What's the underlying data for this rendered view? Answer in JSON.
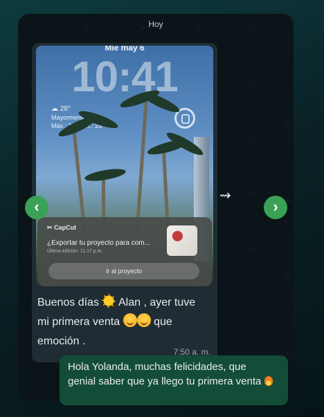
{
  "date_separator": "Hoy",
  "media": {
    "lock_date": "Mié may 6",
    "lock_time": "10:41",
    "weather_temp": "28°",
    "weather_desc": "Mayormente nubl...",
    "weather_range": "Máx.: 30° Mín.: 25°",
    "notification": {
      "app": "CapCut",
      "title": "¿Exportar tu proyecto para com...",
      "subtitle": "Última edición: 11:17 p.m.",
      "button": "Ir al proyecto"
    }
  },
  "incoming_message": {
    "line1_a": "Buenos días",
    "line1_b": "Alan , ayer tuve",
    "line2_a": "mi primera venta",
    "line2_b": "que",
    "line3": "emoción .",
    "time": "7:50 a. m."
  },
  "outgoing_message": {
    "text": "Hola Yolanda, muchas felicidades, que genial saber que ya llego tu primera venta"
  },
  "nav": {
    "prev": "‹",
    "next": "›"
  },
  "forward_glyph": "⇝",
  "pager": {
    "count": 20,
    "active_index": 17
  },
  "colors": {
    "accent": "#3aa157",
    "incoming_bubble": "#1f2c33",
    "outgoing_bubble": "#144d37"
  }
}
